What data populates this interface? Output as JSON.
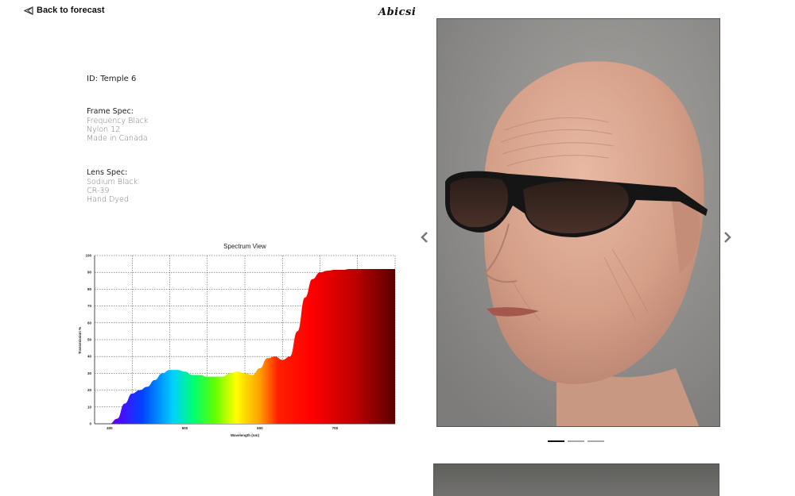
{
  "nav": {
    "back_label": "Back to forecast"
  },
  "brand": {
    "logo_text": "Abicsi"
  },
  "product": {
    "id_line": "ID: Temple 6",
    "frame_spec": {
      "heading": "Frame Spec:",
      "lines": [
        "Frequency Black",
        "Nylon 12",
        "Made in Canada"
      ]
    },
    "lens_spec": {
      "heading": "Lens Spec:",
      "lines": [
        "Sodium Black",
        "CR-39",
        "Hand Dyed"
      ]
    }
  },
  "gallery": {
    "slide_count": 3,
    "active_index": 0
  },
  "chart_data": {
    "type": "area",
    "title": "Spectrum View",
    "xlabel": "Wavelength (nm)",
    "ylabel": "Transmission %",
    "xlim": [
      380,
      780
    ],
    "ylim": [
      0,
      100
    ],
    "xticks": [
      400,
      500,
      600,
      700
    ],
    "yticks": [
      0,
      10,
      20,
      30,
      40,
      50,
      60,
      70,
      80,
      90,
      100
    ],
    "grid": true,
    "colors": {
      "fill": "wavelength-spectrum",
      "grid": "#333333"
    },
    "series": [
      {
        "x": [
          380,
          400,
          410,
          420,
          430,
          440,
          450,
          460,
          470,
          480,
          490,
          500,
          510,
          520,
          530,
          540,
          550,
          560,
          570,
          580,
          590,
          600,
          610,
          620,
          630,
          640,
          650,
          660,
          670,
          680,
          690,
          700,
          710,
          720,
          730,
          740,
          750,
          760,
          770,
          780
        ],
        "y": [
          0,
          0,
          3,
          12,
          18,
          20,
          22,
          26,
          30,
          32,
          32,
          31,
          29,
          29,
          28,
          28,
          28,
          30,
          31,
          30,
          29,
          33,
          39,
          40,
          38,
          40,
          55,
          75,
          86,
          90,
          91,
          91.5,
          91.5,
          92,
          92,
          92,
          92,
          92,
          92,
          92
        ]
      }
    ]
  }
}
